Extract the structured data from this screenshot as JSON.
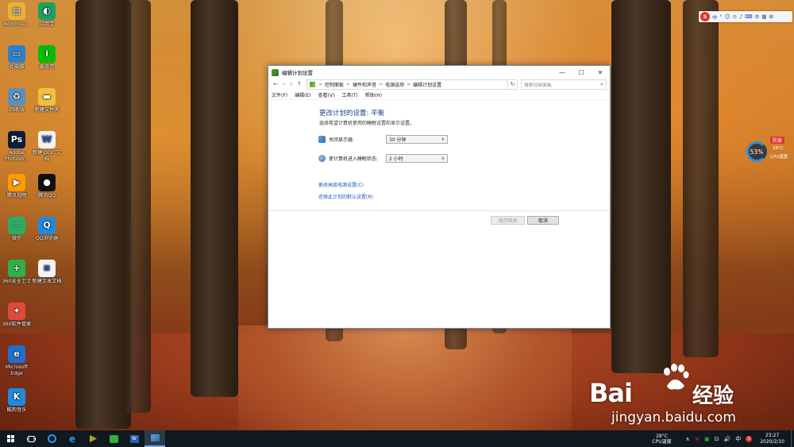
{
  "desktop": {
    "icons": [
      {
        "label": "Administ...",
        "icon": "user-folder-icon",
        "color": "#e8b33a"
      },
      {
        "label": "应用宝",
        "icon": "app-store-icon",
        "color": "#1aa260"
      },
      {
        "label": "此电脑",
        "icon": "computer-icon",
        "color": "#2f7fd0"
      },
      {
        "label": "爱奇艺",
        "icon": "iqiyi-icon",
        "color": "#00be06"
      },
      {
        "label": "回收站",
        "icon": "recycle-bin-icon",
        "color": "#5a8fbf"
      },
      {
        "label": "新建文件夹",
        "icon": "folder-icon",
        "color": "#f0c040"
      },
      {
        "label": "Adobe Photosh...",
        "icon": "photoshop-icon",
        "color": "#0b1e3c"
      },
      {
        "label": "新建 DOC 文档",
        "icon": "doc-file-icon",
        "color": "#f4f4f4"
      },
      {
        "label": "腾讯视频",
        "icon": "tencent-video-icon",
        "color": "#ff9a00"
      },
      {
        "label": "腾讯QQ",
        "icon": "qq-penguin-icon",
        "color": "#111111"
      },
      {
        "label": "微信",
        "icon": "wechat-icon",
        "color": "#2aae67"
      },
      {
        "label": "QQ浏览器",
        "icon": "qq-browser-icon",
        "color": "#1f8be0"
      },
      {
        "label": "360安全卫士",
        "icon": "shield-360-icon",
        "color": "#2fb04a"
      },
      {
        "label": "新建文本文档",
        "icon": "text-file-icon",
        "color": "#f4f4f4"
      },
      {
        "label": "360软件管家",
        "icon": "software-manager-icon",
        "color": "#e04a3a"
      },
      {
        "label": "Microsoft Edge",
        "icon": "edge-icon",
        "color": "#1f6fd0"
      },
      {
        "label": "酷狗音乐",
        "icon": "kugou-icon",
        "color": "#1f8be0"
      }
    ]
  },
  "window": {
    "title": "编辑计划设置",
    "address": {
      "crumbs": [
        "控制面板",
        "硬件和声音",
        "电源选项",
        "编辑计划设置"
      ],
      "separator": ">",
      "search_placeholder": "搜索控制面板"
    },
    "nav": {
      "back": "←",
      "forward": "→",
      "recent": "∨",
      "up": "↑",
      "refresh": "↻",
      "search_icon": "⌕"
    },
    "window_controls": {
      "minimize": "—",
      "maximize": "☐",
      "close": "✕"
    },
    "menu": [
      "文件(F)",
      "编辑(E)",
      "查看(V)",
      "工具(T)",
      "帮助(H)"
    ],
    "heading": "更改计划的设置: 平衡",
    "subtitle": "选择希望计算机使用的睡眠设置和显示设置。",
    "settings": [
      {
        "label": "关闭显示器:",
        "value": "30 分钟",
        "icon": "monitor-icon"
      },
      {
        "label": "使计算机进入睡眠状态:",
        "value": "2 小时",
        "icon": "moon-sleep-icon"
      }
    ],
    "links": {
      "advanced": "更改高级电源设置(C)",
      "restore": "还原此计划的默认设置(R)"
    },
    "buttons": {
      "save": "保存修改",
      "cancel": "取消"
    }
  },
  "ime_bar": {
    "logo": "S",
    "items": [
      "中",
      "°",
      "☺",
      "⊙",
      "♪",
      "⌨",
      "⚙",
      "▦",
      "⊞"
    ]
  },
  "cpu_widget": {
    "percent": "53%",
    "tag": "防爱",
    "temp": "28°C",
    "label": "CPU温度"
  },
  "watermark": {
    "brand_latin": "Bai",
    "brand_cn": "经验",
    "url": "jingyan.baidu.com"
  },
  "taskbar": {
    "cpu_temp": "28°C",
    "cpu_label": "CPU温度",
    "tray_glyphs": [
      "∧",
      "☣",
      "▣",
      "⊡",
      "🔊",
      "中",
      "S"
    ],
    "time": "23:27",
    "date": "2020/2/10"
  }
}
